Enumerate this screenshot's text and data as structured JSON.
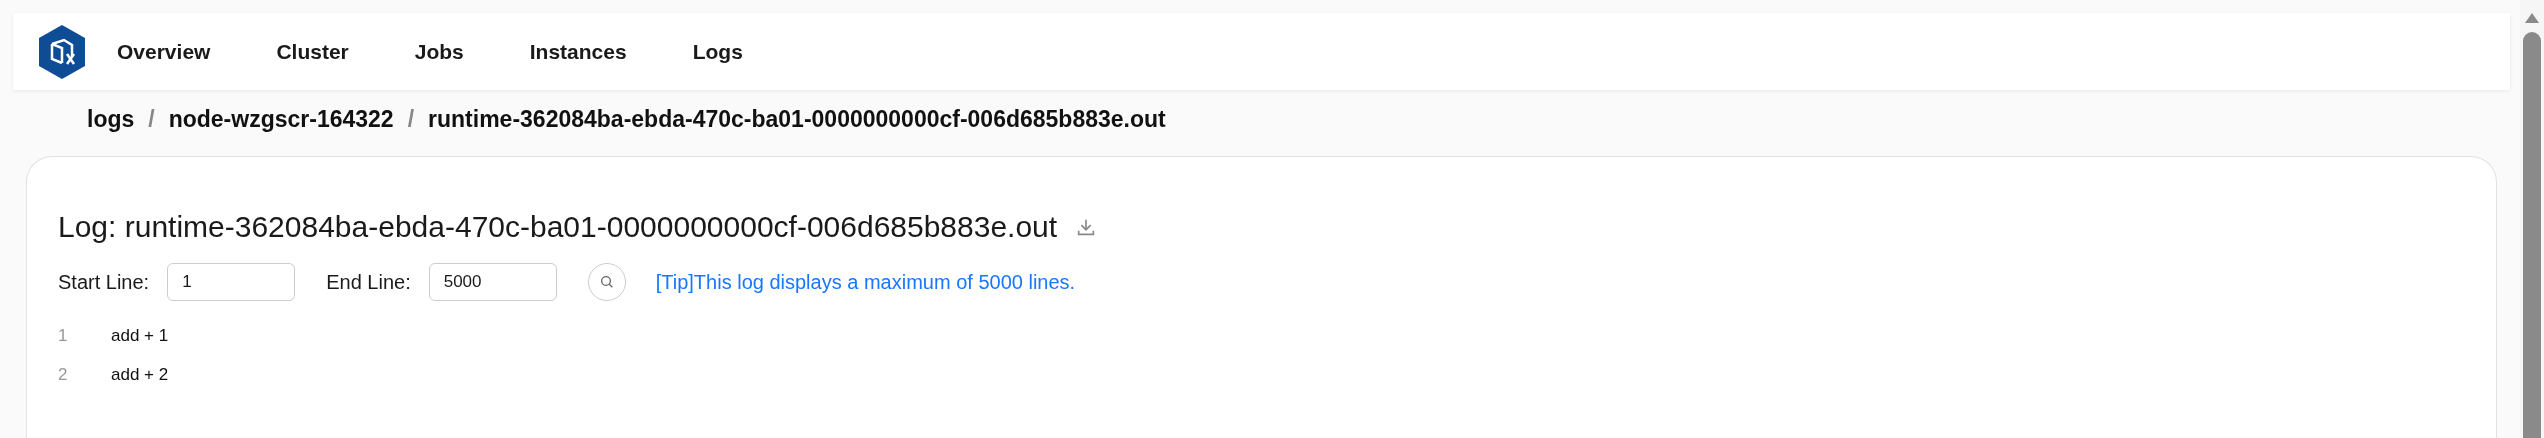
{
  "nav": {
    "items": [
      {
        "label": "Overview"
      },
      {
        "label": "Cluster"
      },
      {
        "label": "Jobs"
      },
      {
        "label": "Instances"
      },
      {
        "label": "Logs"
      }
    ]
  },
  "breadcrumb": [
    "logs",
    "node-wzgscr-164322",
    "runtime-362084ba-ebda-470c-ba01-0000000000cf-006d685b883e.out"
  ],
  "breadcrumb_separator": "/",
  "log": {
    "title": "Log: runtime-362084ba-ebda-470c-ba01-0000000000cf-006d685b883e.out",
    "start_line": {
      "label": "Start Line:",
      "value": "1"
    },
    "end_line": {
      "label": "End Line:",
      "value": "5000"
    },
    "tip": "[Tip]This log displays a maximum of 5000 lines.",
    "lines": [
      {
        "number": "1",
        "text": "add + 1"
      },
      {
        "number": "2",
        "text": "add + 2"
      }
    ]
  }
}
